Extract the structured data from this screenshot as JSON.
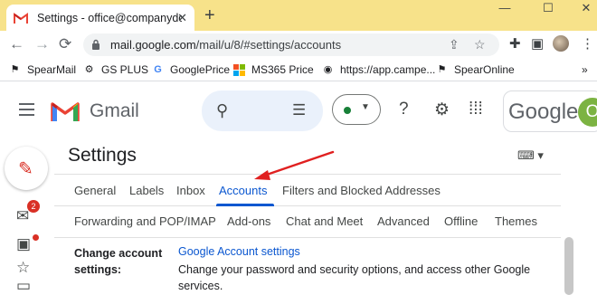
{
  "browser": {
    "tab_title": "Settings - office@companydoma",
    "new_tab": "+",
    "window": {
      "minimize": "—",
      "maximize": "☐",
      "close": "✕"
    },
    "url_host": "mail.google.com",
    "url_path": "/mail/u/8/#settings/accounts",
    "bookmarks": [
      {
        "label": "SpearMail",
        "icon": "spear-icon"
      },
      {
        "label": "GS PLUS",
        "icon": "gs-plus-icon"
      },
      {
        "label": "GooglePrice",
        "icon": "google-g-icon"
      },
      {
        "label": "MS365 Price",
        "icon": "microsoft-icon"
      },
      {
        "label": "https://app.campe...",
        "icon": "globe-icon"
      },
      {
        "label": "SpearOnline",
        "icon": "spear-icon"
      }
    ],
    "bookmarks_more": "»"
  },
  "gmail": {
    "product_name": "Gmail",
    "google_word": "Google",
    "account_initial": "O",
    "status_color": "#188038"
  },
  "rail": {
    "mail_badge": "2"
  },
  "settings": {
    "title": "Settings",
    "tabs_row1": [
      "General",
      "Labels",
      "Inbox",
      "Accounts",
      "Filters and Blocked Addresses"
    ],
    "tabs_row2": [
      "Forwarding and POP/IMAP",
      "Add-ons",
      "Chat and Meet",
      "Advanced",
      "Offline",
      "Themes"
    ],
    "active_tab": "Accounts",
    "section": {
      "label_line1": "Change account",
      "label_line2": "settings:",
      "link": "Google Account settings",
      "description": "Change your password and security options, and access other Google services."
    }
  },
  "colors": {
    "accent": "#0b57d0",
    "tabstrip": "#f7e28a",
    "annotation_arrow": "#e02020"
  }
}
